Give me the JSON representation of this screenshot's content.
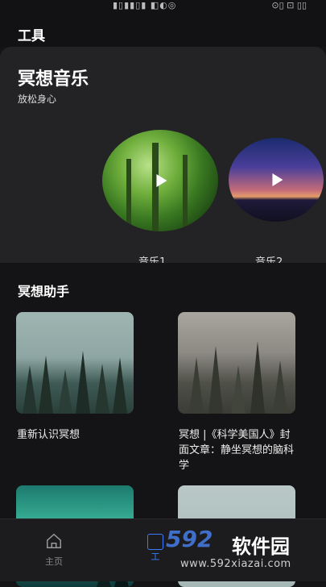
{
  "status": {
    "glyphs": "▮▯▮▮▯▮ ◧◐◎",
    "right": "⊙▯ ⊡ ▯▯"
  },
  "header": {
    "title": "工具"
  },
  "music": {
    "title": "冥想音乐",
    "subtitle": "放松身心",
    "items": [
      {
        "label": "音乐1"
      },
      {
        "label": "音乐2"
      }
    ]
  },
  "assistant": {
    "title": "冥想助手",
    "cards": [
      {
        "title": "重新认识冥想"
      },
      {
        "title": "冥想 |《科学美国人》封面文章：静坐冥想的脑科学"
      },
      {
        "title": ""
      },
      {
        "title": ""
      }
    ]
  },
  "tabbar": {
    "tabs": [
      {
        "label": "主页"
      },
      {
        "label": "工"
      }
    ]
  },
  "watermark": {
    "logo": "592",
    "name": "软件园",
    "url": "www.592xiazai.com"
  }
}
